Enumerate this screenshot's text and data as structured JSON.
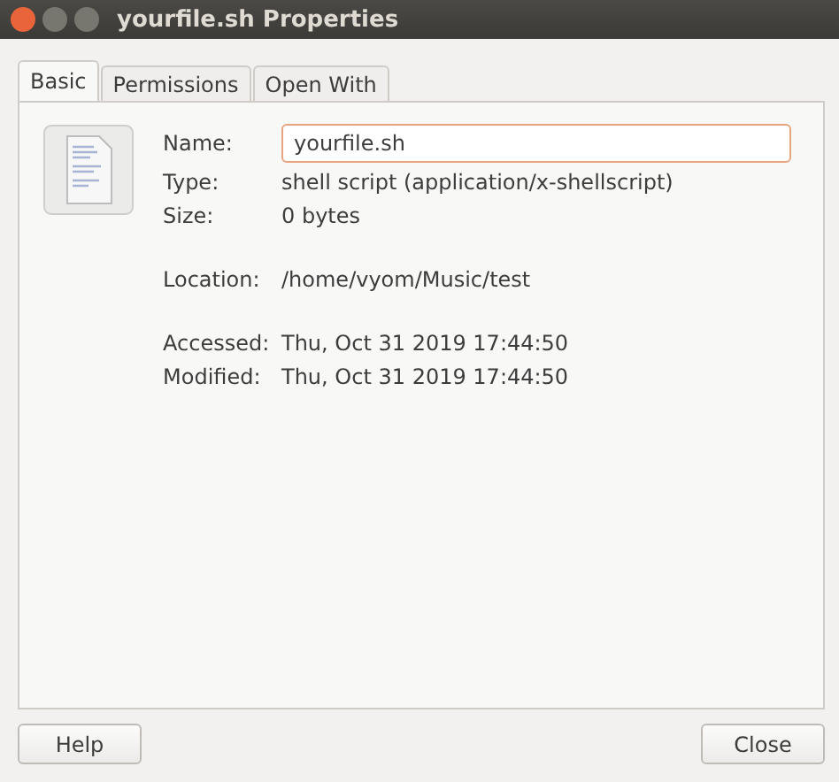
{
  "window": {
    "title": "yourfile.sh Properties"
  },
  "tabs": [
    {
      "label": "Basic",
      "selected": true
    },
    {
      "label": "Permissions",
      "selected": false
    },
    {
      "label": "Open With",
      "selected": false
    }
  ],
  "name_field": {
    "label": "Name:",
    "value": "yourfile.sh"
  },
  "groups": [
    [
      {
        "label": "Type:",
        "value": "shell script (application/x-shellscript)"
      },
      {
        "label": "Size:",
        "value": "0 bytes"
      }
    ],
    [
      {
        "label": "Location:",
        "value": "/home/vyom/Music/test"
      }
    ],
    [
      {
        "label": "Accessed:",
        "value": "Thu, Oct 31 2019 17:44:50"
      },
      {
        "label": "Modified:",
        "value": "Thu, Oct 31 2019 17:44:50"
      }
    ]
  ],
  "buttons": [
    "Help",
    "Close"
  ]
}
